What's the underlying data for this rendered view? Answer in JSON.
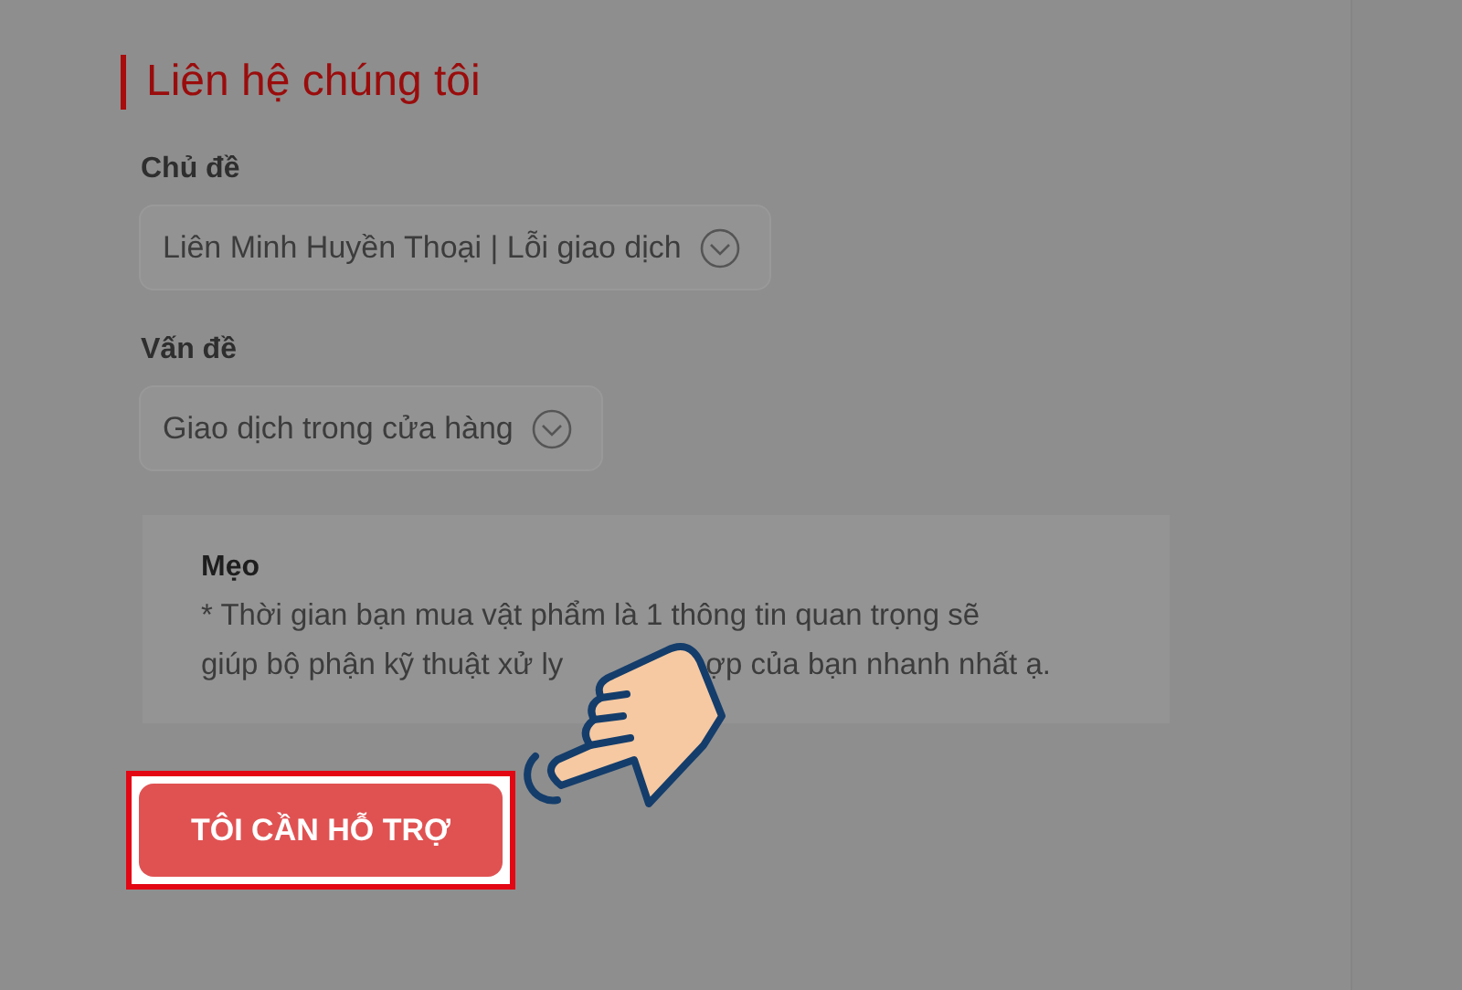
{
  "heading": "Liên hệ chúng tôi",
  "fields": [
    {
      "label": "Chủ đề",
      "value": "Liên Minh Huyền Thoại | Lỗi giao dịch"
    },
    {
      "label": "Vấn đề",
      "value": "Giao dịch trong cửa hàng"
    }
  ],
  "tip": {
    "title": "Mẹo",
    "line_1": "* Thời gian bạn mua vật phẩm là 1 thông tin quan trọng sẽ",
    "line_2_start": "giúp bộ phận kỹ thuật xử ly",
    "line_2_end": "ợp của bạn nhanh nhất ạ."
  },
  "submit_button": {
    "label": "TÔI CẦN HỖ TRỢ",
    "highlighted": true
  }
}
